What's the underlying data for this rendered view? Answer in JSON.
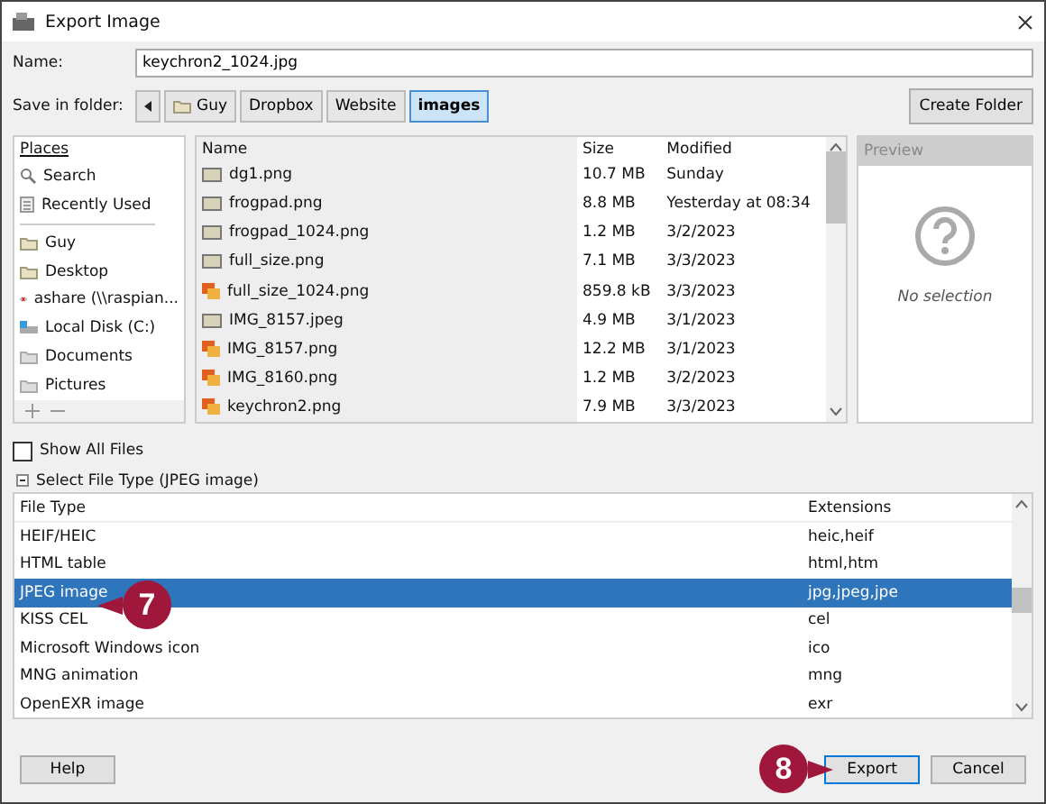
{
  "window": {
    "title": "Export Image"
  },
  "name_field": {
    "label": "Name:",
    "value": "keychron2_1024.jpg"
  },
  "save_in_folder": {
    "label": "Save in folder:",
    "crumbs": [
      {
        "label": "Guy",
        "kind": "folder",
        "selected": false
      },
      {
        "label": "Dropbox",
        "kind": "plain",
        "selected": false
      },
      {
        "label": "Website",
        "kind": "plain",
        "selected": false
      },
      {
        "label": "images",
        "kind": "plain",
        "selected": true
      }
    ],
    "create_folder": "Create Folder"
  },
  "places": {
    "heading": "Places",
    "items": [
      {
        "label": "Search",
        "kind": "search"
      },
      {
        "label": "Recently Used",
        "kind": "recent"
      },
      {
        "label": "Guy",
        "kind": "folder"
      },
      {
        "label": "Desktop",
        "kind": "folder"
      },
      {
        "label": "ashare (\\\\raspian...",
        "kind": "network"
      },
      {
        "label": "Local Disk (C:)",
        "kind": "drive"
      },
      {
        "label": "Documents",
        "kind": "gray-folder"
      },
      {
        "label": "Pictures",
        "kind": "gray-folder"
      }
    ]
  },
  "files": {
    "columns": [
      "Name",
      "Size",
      "Modified"
    ],
    "rows": [
      {
        "name": "dg1.png",
        "size": "10.7 MB",
        "modified": "Sunday",
        "kind": "thumbnail"
      },
      {
        "name": "frogpad.png",
        "size": "8.8 MB",
        "modified": "Yesterday at 08:34",
        "kind": "thumbnail"
      },
      {
        "name": "frogpad_1024.png",
        "size": "1.2 MB",
        "modified": "3/2/2023",
        "kind": "thumbnail"
      },
      {
        "name": "full_size.png",
        "size": "7.1 MB",
        "modified": "3/3/2023",
        "kind": "thumbnail"
      },
      {
        "name": "full_size_1024.png",
        "size": "859.8 kB",
        "modified": "3/3/2023",
        "kind": "image"
      },
      {
        "name": "IMG_8157.jpeg",
        "size": "4.9 MB",
        "modified": "3/1/2023",
        "kind": "thumbnail"
      },
      {
        "name": "IMG_8157.png",
        "size": "12.2 MB",
        "modified": "3/1/2023",
        "kind": "image"
      },
      {
        "name": "IMG_8160.png",
        "size": "1.2 MB",
        "modified": "3/2/2023",
        "kind": "image"
      },
      {
        "name": "keychron2.png",
        "size": "7.9 MB",
        "modified": "3/3/2023",
        "kind": "image"
      }
    ]
  },
  "preview": {
    "heading": "Preview",
    "message": "No selection"
  },
  "show_all_files": {
    "label": "Show All Files",
    "checked": false
  },
  "file_type": {
    "label": "Select File Type (JPEG image)",
    "expanded": true,
    "columns": [
      "File Type",
      "Extensions"
    ],
    "rows": [
      {
        "type": "HEIF/HEIC",
        "extensions": "heic,heif",
        "selected": false
      },
      {
        "type": "HTML table",
        "extensions": "html,htm",
        "selected": false
      },
      {
        "type": "JPEG image",
        "extensions": "jpg,jpeg,jpe",
        "selected": true
      },
      {
        "type": "KISS CEL",
        "extensions": "cel",
        "selected": false
      },
      {
        "type": "Microsoft Windows icon",
        "extensions": "ico",
        "selected": false
      },
      {
        "type": "MNG animation",
        "extensions": "mng",
        "selected": false
      },
      {
        "type": "OpenEXR image",
        "extensions": "exr",
        "selected": false
      }
    ]
  },
  "buttons": {
    "help": "Help",
    "export": "Export",
    "cancel": "Cancel"
  },
  "callouts": [
    {
      "label": "7"
    },
    {
      "label": "8"
    }
  ]
}
